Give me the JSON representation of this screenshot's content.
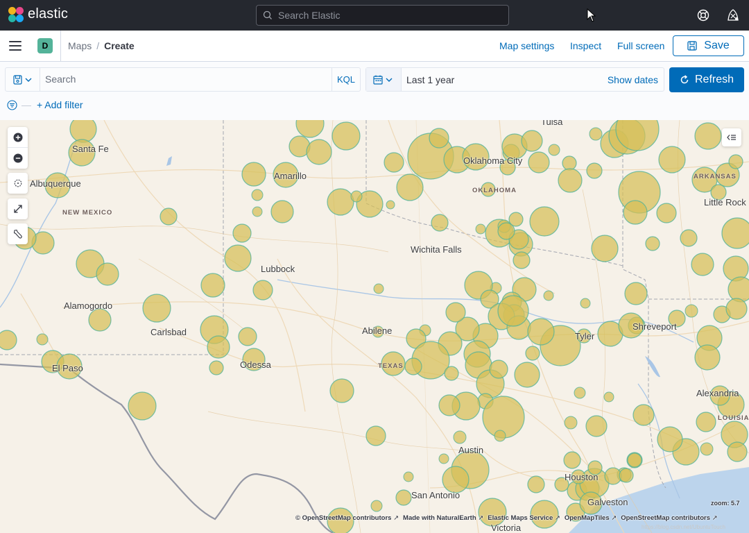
{
  "app": {
    "brand": "elastic",
    "search_placeholder": "Search Elastic"
  },
  "header": {
    "space_initial": "D",
    "breadcrumb": [
      "Maps",
      "Create"
    ],
    "links": {
      "map_settings": "Map settings",
      "inspect": "Inspect",
      "full_screen": "Full screen"
    },
    "save_label": "Save"
  },
  "query": {
    "search_placeholder": "Search",
    "language": "KQL",
    "time_range": "Last 1 year",
    "show_dates": "Show dates",
    "refresh_label": "Refresh",
    "add_filter": "+ Add filter"
  },
  "map": {
    "cities": [
      "Santa Fe",
      "Albuquerque",
      "Amarillo",
      "Oklahoma City",
      "Tulsa",
      "Little Rock",
      "Wichita Falls",
      "Lubbock",
      "Alamogordo",
      "Carlsbad",
      "Abilene",
      "Odessa",
      "El Paso",
      "Tyler",
      "Shreveport",
      "Alexandria",
      "Austin",
      "Houston",
      "San Antonio",
      "Galveston",
      "Victoria"
    ],
    "regions": [
      "NEW MEXICO",
      "OKLAHOMA",
      "TEXAS",
      "ARKANSAS",
      "LOUISIANA"
    ],
    "zoom_label": "zoom: 5.7",
    "attribution": [
      "© OpenStreetMap contributors",
      "Made with NaturalEarth",
      "Elastic Maps Service",
      "OpenMapTiles",
      "OpenStreetMap contributors"
    ],
    "watermark": "https://blog.csdn.net/UbuntuTouch",
    "point_color": "#d6bf57",
    "point_stroke": "#54b399"
  }
}
